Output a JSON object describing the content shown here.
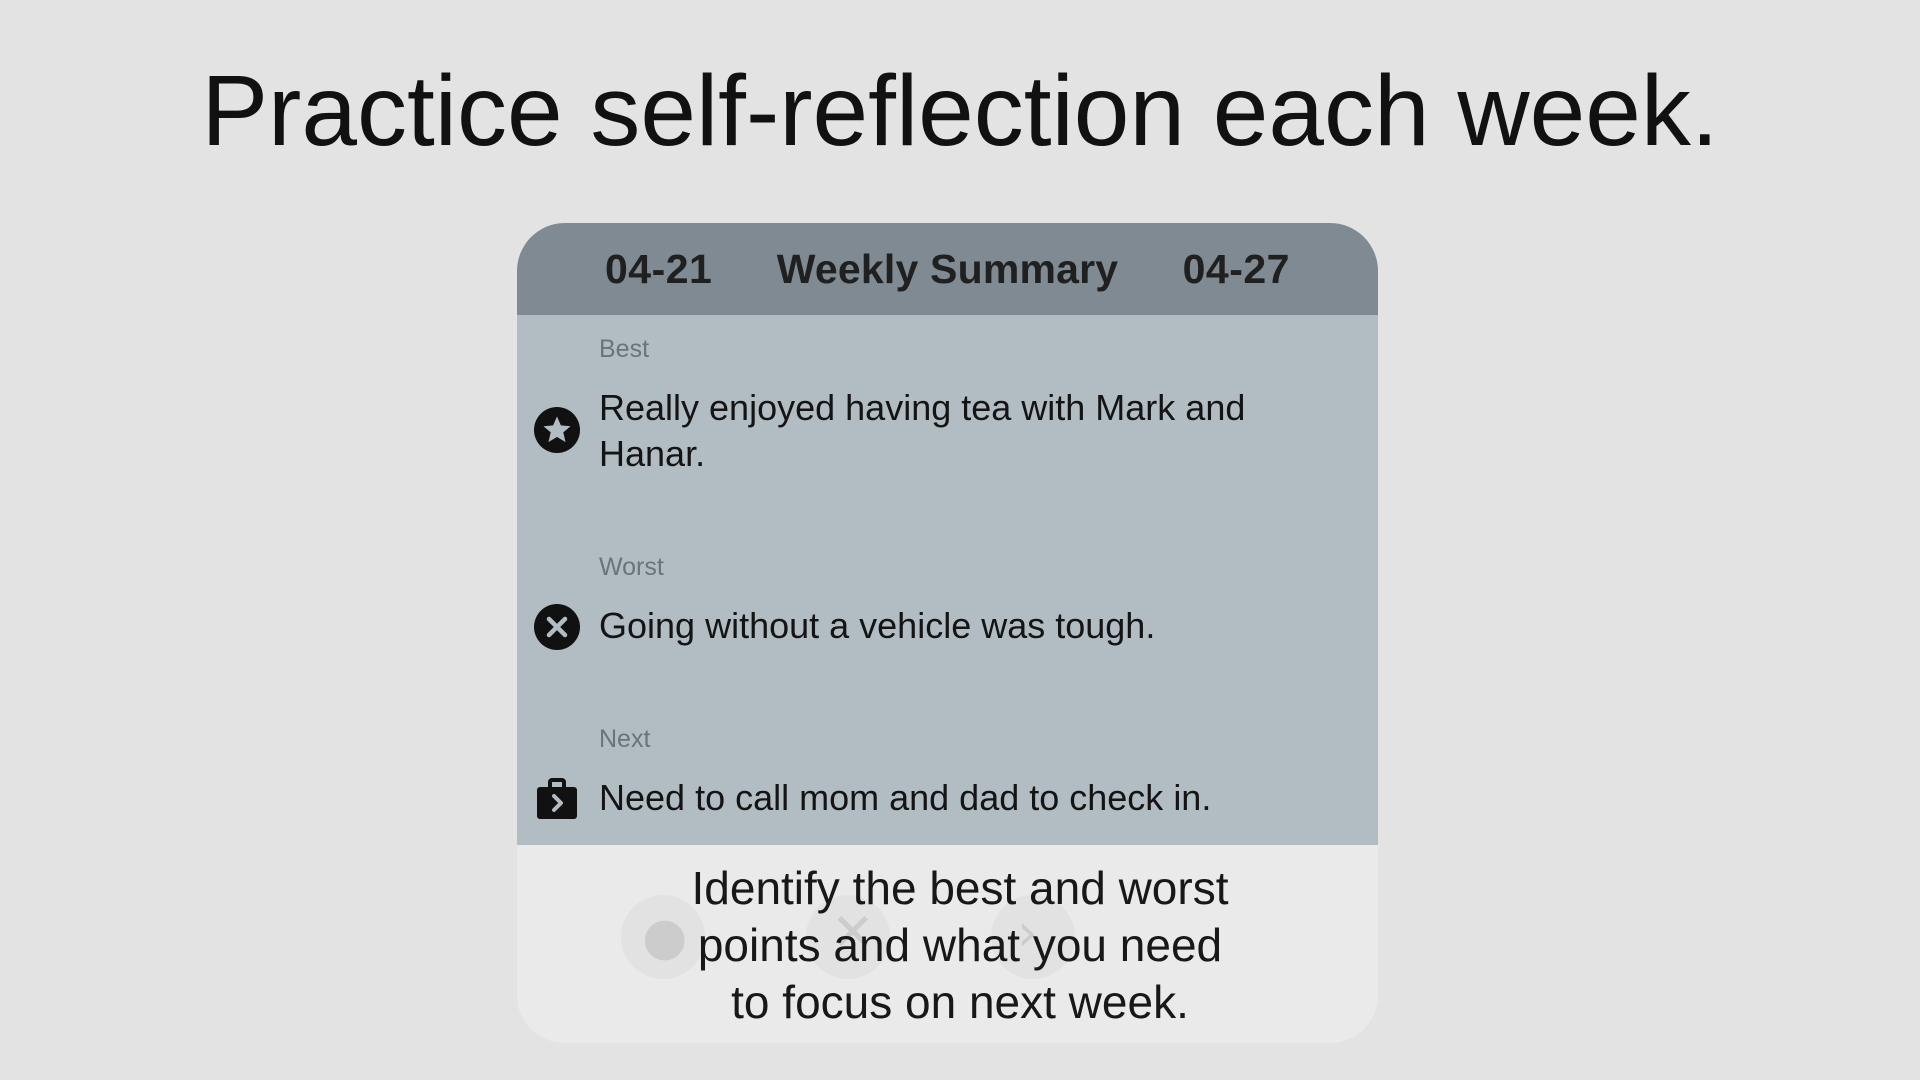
{
  "headline": "Practice self-reflection each week.",
  "summary_card": {
    "start_date": "04-21",
    "title": "Weekly Summary",
    "end_date": "04-27",
    "sections": [
      {
        "label": "Best",
        "icon": "star-icon",
        "text": "Really enjoyed having tea with Mark and Hanar."
      },
      {
        "label": "Worst",
        "icon": "x-circle-icon",
        "text": "Going without a vehicle was tough."
      },
      {
        "label": "Next",
        "icon": "briefcase-next-icon",
        "text": "Need to call mom and dad to check in."
      }
    ]
  },
  "caption": {
    "line1": "Identify the best and worst",
    "line2": "points and what you need",
    "line3": "to focus on next week."
  },
  "colors": {
    "background": "#e3e3e3",
    "header": "#7f8a92",
    "body": "#b2bcc3",
    "footer": "#eaeaea",
    "label": "#69747b",
    "text": "#141414"
  }
}
